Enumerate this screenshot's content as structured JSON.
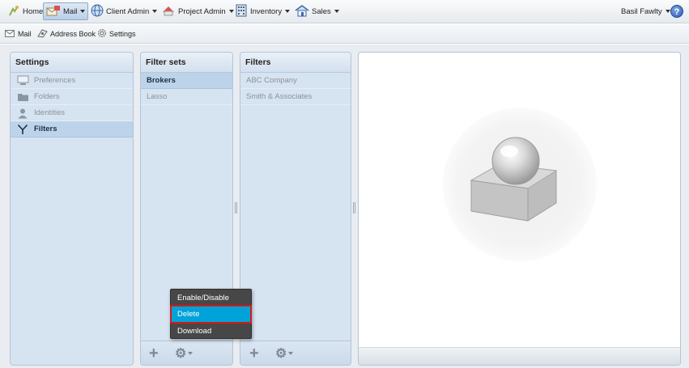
{
  "topbar": {
    "nav": [
      {
        "label": "Home",
        "icon": "home-icon",
        "dropdown": false
      },
      {
        "label": "Mail",
        "icon": "mail-icon",
        "dropdown": true,
        "active": true
      },
      {
        "label": "Client Admin",
        "icon": "globe-icon",
        "dropdown": true
      },
      {
        "label": "Project Admin",
        "icon": "project-icon",
        "dropdown": true
      },
      {
        "label": "Inventory",
        "icon": "inventory-icon",
        "dropdown": true
      },
      {
        "label": "Sales",
        "icon": "sales-icon",
        "dropdown": true
      }
    ],
    "user": "Basil Fawlty",
    "help": "?"
  },
  "subbar": {
    "items": [
      {
        "label": "Mail",
        "icon": "mail-small-icon"
      },
      {
        "label": "Address Book",
        "icon": "address-book-icon"
      },
      {
        "label": "Settings",
        "icon": "settings-gear-icon"
      }
    ]
  },
  "settings_pane": {
    "title": "Settings",
    "items": [
      {
        "label": "Preferences",
        "icon": "monitor-icon",
        "selected": false
      },
      {
        "label": "Folders",
        "icon": "folder-icon",
        "selected": false
      },
      {
        "label": "Identities",
        "icon": "person-icon",
        "selected": false
      },
      {
        "label": "Filters",
        "icon": "filter-icon",
        "selected": true
      }
    ]
  },
  "filtersets_pane": {
    "title": "Filter sets",
    "items": [
      {
        "label": "Brokers",
        "selected": true
      },
      {
        "label": "Lasso",
        "selected": false
      }
    ]
  },
  "filters_pane": {
    "title": "Filters",
    "items": [
      {
        "label": "ABC Company"
      },
      {
        "label": "Smith & Associates"
      }
    ]
  },
  "footer": {
    "add": "+",
    "actions": "⚙"
  },
  "popup_menu": {
    "items": [
      {
        "label": "Enable/Disable",
        "highlighted": false
      },
      {
        "label": "Delete",
        "highlighted": true
      },
      {
        "label": "Download",
        "highlighted": false
      }
    ]
  },
  "colors": {
    "pane_bg": "#d6e3f1",
    "selected_row": "#bcd3ea",
    "popup_bg": "#474747",
    "popup_highlight": "#00a3d9",
    "highlight_border": "#d11c1c"
  }
}
